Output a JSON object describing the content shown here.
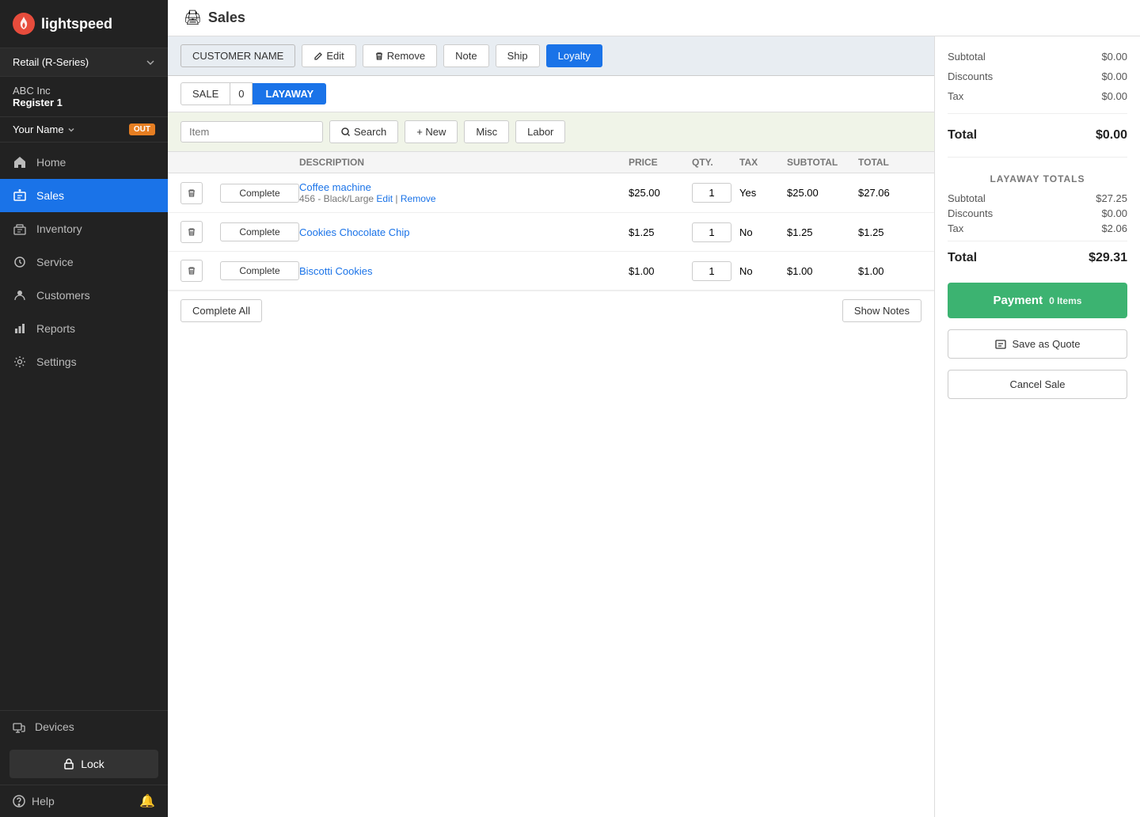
{
  "sidebar": {
    "logo_text": "lightspeed",
    "store_selector": "Retail (R-Series)",
    "store_name": "ABC Inc",
    "register": "Register 1",
    "user_name": "Your Name",
    "out_badge": "OUT",
    "nav_items": [
      {
        "id": "home",
        "label": "Home",
        "icon": "home"
      },
      {
        "id": "sales",
        "label": "Sales",
        "icon": "sales",
        "active": true
      },
      {
        "id": "inventory",
        "label": "Inventory",
        "icon": "inventory"
      },
      {
        "id": "service",
        "label": "Service",
        "icon": "service"
      },
      {
        "id": "customers",
        "label": "Customers",
        "icon": "customers"
      },
      {
        "id": "reports",
        "label": "Reports",
        "icon": "reports"
      },
      {
        "id": "settings",
        "label": "Settings",
        "icon": "settings"
      }
    ],
    "devices_label": "Devices",
    "lock_label": "Lock",
    "help_label": "Help"
  },
  "header": {
    "page_icon": "🖨",
    "title": "Sales"
  },
  "customer_bar": {
    "customer_name_btn": "CUSTOMER NAME",
    "edit_btn": "Edit",
    "remove_btn": "Remove",
    "note_btn": "Note",
    "ship_btn": "Ship",
    "loyalty_btn": "Loyalty"
  },
  "tabs": {
    "sale_label": "SALE",
    "sale_count": "0",
    "layaway_label": "LAYAWAY"
  },
  "search": {
    "item_placeholder": "Item",
    "search_btn": "Search",
    "new_btn": "+ New",
    "misc_btn": "Misc",
    "labor_btn": "Labor"
  },
  "table": {
    "headers": [
      "",
      "",
      "DESCRIPTION",
      "PRICE",
      "QTY.",
      "TAX",
      "SUBTOTAL",
      "TOTAL"
    ],
    "rows": [
      {
        "id": 1,
        "name": "Coffee machine",
        "sub": "456 - Black/Large",
        "price": "$25.00",
        "qty": "1",
        "tax": "Yes",
        "subtotal": "$25.00",
        "total": "$27.06",
        "complete_label": "Complete"
      },
      {
        "id": 2,
        "name": "Cookies Chocolate Chip",
        "sub": "",
        "price": "$1.25",
        "qty": "1",
        "tax": "No",
        "subtotal": "$1.25",
        "total": "$1.25",
        "complete_label": "Complete"
      },
      {
        "id": 3,
        "name": "Biscotti Cookies",
        "sub": "",
        "price": "$1.00",
        "qty": "1",
        "tax": "No",
        "subtotal": "$1.00",
        "total": "$1.00",
        "complete_label": "Complete"
      }
    ],
    "complete_all_btn": "Complete All",
    "show_notes_btn": "Show Notes"
  },
  "right_panel": {
    "subtotal_label": "Subtotal",
    "subtotal_value": "$0.00",
    "discounts_label": "Discounts",
    "discounts_value": "$0.00",
    "tax_label": "Tax",
    "tax_value": "$0.00",
    "total_label": "Total",
    "total_value": "$0.00",
    "layaway_totals_title": "LAYAWAY TOTALS",
    "lay_subtotal_label": "Subtotal",
    "lay_subtotal_value": "$27.25",
    "lay_discounts_label": "Discounts",
    "lay_discounts_value": "$0.00",
    "lay_tax_label": "Tax",
    "lay_tax_value": "$2.06",
    "lay_total_label": "Total",
    "lay_total_value": "$29.31",
    "payment_btn": "Payment",
    "payment_items": "0 Items",
    "save_quote_btn": "Save as Quote",
    "cancel_sale_btn": "Cancel Sale"
  }
}
